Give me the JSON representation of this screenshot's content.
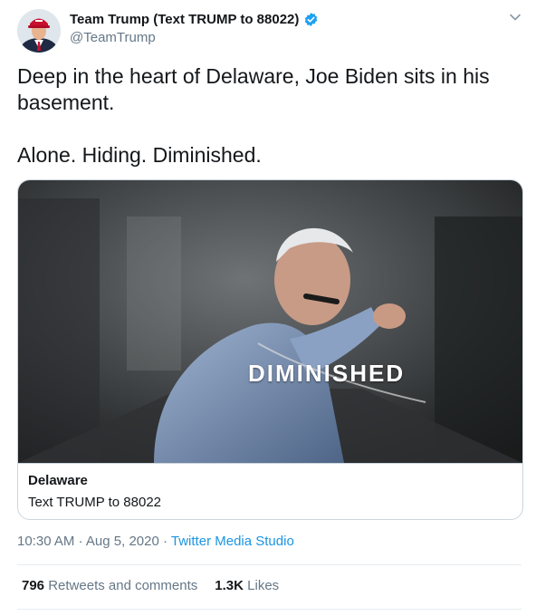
{
  "author": {
    "display_name": "Team Trump (Text TRUMP to 88022)",
    "handle": "@TeamTrump",
    "verified": true
  },
  "tweet": {
    "text": "Deep in the heart of Delaware, Joe Biden sits in his basement.\n\nAlone. Hiding. Diminished."
  },
  "card": {
    "overlay_text": "DIMINISHED",
    "title": "Delaware",
    "description": "Text TRUMP to 88022"
  },
  "meta": {
    "time": "10:30 AM",
    "separator": "·",
    "date": "Aug 5, 2020",
    "source": "Twitter Media Studio"
  },
  "stats": {
    "retweets_count": "796",
    "retweets_label": "Retweets and comments",
    "likes_count": "1.3K",
    "likes_label": "Likes"
  },
  "colors": {
    "link": "#1b95e0",
    "verified": "#1da1f2",
    "muted": "#657786"
  },
  "icons": {
    "verified": "verified-badge-icon",
    "caret": "chevron-down-icon"
  }
}
